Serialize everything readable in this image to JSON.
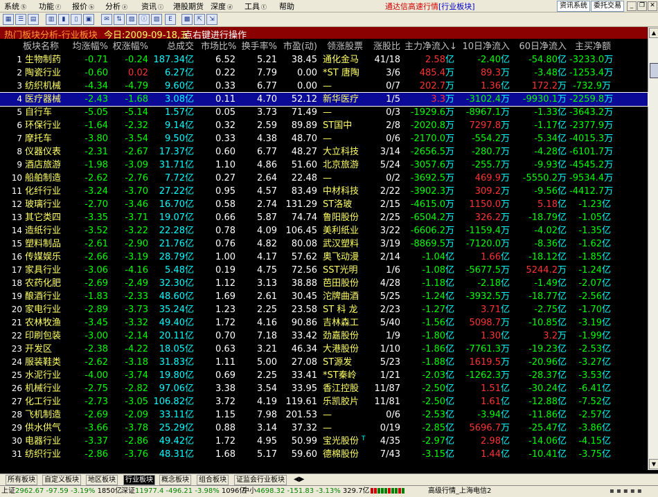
{
  "menubar": {
    "items": [
      "系统",
      "功能",
      "报价",
      "分析",
      "资讯",
      "港股期货",
      "深度",
      "工具",
      "帮助"
    ],
    "has_arrow": [
      true,
      true,
      true,
      true,
      true,
      false,
      true,
      true,
      false
    ],
    "app_title": "通达信高速行情",
    "app_subtitle": "[行业板块]",
    "btn_news": "资讯系统",
    "btn_trade": "委托交易"
  },
  "header": {
    "board_title": "热门板块分析-行业板块",
    "today": "今日:2009-09-18,五",
    "hint": "点右键进行操作"
  },
  "columns": [
    "板块名称",
    "均涨幅%",
    "权涨幅%",
    "总成交",
    "市场比%",
    "换手率%",
    "市盈(动)",
    "领涨股票",
    "涨股比",
    "主力净流入↓",
    "10日净流入",
    "60日净流入",
    "主买净额"
  ],
  "units": {
    "yi": "亿",
    "wan": "万"
  },
  "rows": [
    {
      "i": "1",
      "name": "生物制药",
      "avg": "-0.71",
      "wt": "-0.24",
      "vol": "187.34",
      "mkt": "6.52",
      "turn": "5.21",
      "pe": "38.45",
      "lead": "通化金马",
      "ratio": "41/18",
      "main": "2.58",
      "main_u": "亿",
      "d10": "-2.40",
      "d10_u": "亿",
      "d60": "-54.80",
      "d60_u": "亿",
      "buy": "-3233.0",
      "buy_u": "万"
    },
    {
      "i": "2",
      "name": "陶瓷行业",
      "avg": "-0.60",
      "wt": "0.02",
      "vol": "6.27",
      "mkt": "0.22",
      "turn": "7.79",
      "pe": "0.00",
      "lead": "*ST 唐陶",
      "ratio": "3/6",
      "main": "485.4",
      "main_u": "万",
      "d10": "89.3",
      "d10_u": "万",
      "d60": "-3.48",
      "d60_u": "亿",
      "buy": "-1253.4",
      "buy_u": "万"
    },
    {
      "i": "3",
      "name": "纺织机械",
      "avg": "-4.34",
      "wt": "-4.79",
      "vol": "9.60",
      "mkt": "0.33",
      "turn": "6.77",
      "pe": "0.00",
      "lead": "—",
      "ratio": "0/7",
      "main": "202.7",
      "main_u": "万",
      "d10": "1.36",
      "d10_u": "亿",
      "d60": "172.2",
      "d60_u": "万",
      "buy": "-732.9",
      "buy_u": "万"
    },
    {
      "i": "4",
      "name": "医疗器械",
      "avg": "-2.43",
      "wt": "-1.68",
      "vol": "3.08",
      "mkt": "0.11",
      "turn": "4.70",
      "pe": "52.12",
      "lead": "新华医疗",
      "ratio": "1/5",
      "main": "3.3",
      "main_u": "万",
      "d10": "-3102.4",
      "d10_u": "万",
      "d60": "-9930.1",
      "d60_u": "万",
      "buy": "-2259.8",
      "buy_u": "万"
    },
    {
      "i": "5",
      "name": "自行车",
      "avg": "-5.05",
      "wt": "-5.14",
      "vol": "1.57",
      "mkt": "0.05",
      "turn": "3.73",
      "pe": "71.49",
      "lead": "—",
      "ratio": "0/3",
      "main": "-1929.6",
      "main_u": "万",
      "d10": "-8967.1",
      "d10_u": "万",
      "d60": "-1.33",
      "d60_u": "亿",
      "buy": "-3643.2",
      "buy_u": "万"
    },
    {
      "i": "6",
      "name": "环保行业",
      "avg": "-1.64",
      "wt": "-2.32",
      "vol": "9.14",
      "mkt": "0.32",
      "turn": "2.59",
      "pe": "89.89",
      "lead": "ST国中",
      "ratio": "2/8",
      "main": "-2020.8",
      "main_u": "万",
      "d10": "7297.8",
      "d10_u": "万",
      "d60": "-1.17",
      "d60_u": "亿",
      "buy": "-2377.9",
      "buy_u": "万"
    },
    {
      "i": "7",
      "name": "摩托车",
      "avg": "-3.80",
      "wt": "-3.54",
      "vol": "9.50",
      "mkt": "0.33",
      "turn": "4.38",
      "pe": "48.70",
      "lead": "—",
      "ratio": "0/6",
      "main": "-2170.0",
      "main_u": "万",
      "d10": "-554.2",
      "d10_u": "万",
      "d60": "-5.34",
      "d60_u": "亿",
      "buy": "-4015.3",
      "buy_u": "万"
    },
    {
      "i": "8",
      "name": "仪器仪表",
      "avg": "-2.31",
      "wt": "-2.67",
      "vol": "17.37",
      "mkt": "0.60",
      "turn": "6.77",
      "pe": "48.27",
      "lead": "大立科技",
      "ratio": "3/14",
      "main": "-2656.5",
      "main_u": "万",
      "d10": "-280.7",
      "d10_u": "万",
      "d60": "-4.28",
      "d60_u": "亿",
      "buy": "-6101.7",
      "buy_u": "万"
    },
    {
      "i": "9",
      "name": "酒店旅游",
      "avg": "-1.98",
      "wt": "-3.09",
      "vol": "31.71",
      "mkt": "1.10",
      "turn": "4.86",
      "pe": "51.60",
      "lead": "北京旅游",
      "ratio": "5/24",
      "main": "-3057.6",
      "main_u": "万",
      "d10": "-255.7",
      "d10_u": "万",
      "d60": "-9.93",
      "d60_u": "亿",
      "buy": "-4545.2",
      "buy_u": "万"
    },
    {
      "i": "10",
      "name": "船舶制造",
      "avg": "-2.62",
      "wt": "-2.76",
      "vol": "7.72",
      "mkt": "0.27",
      "turn": "2.64",
      "pe": "22.48",
      "lead": "—",
      "ratio": "0/2",
      "main": "-3692.5",
      "main_u": "万",
      "d10": "469.9",
      "d10_u": "万",
      "d60": "-5550.2",
      "d60_u": "万",
      "buy": "-9534.4",
      "buy_u": "万"
    },
    {
      "i": "11",
      "name": "化纤行业",
      "avg": "-3.24",
      "wt": "-3.70",
      "vol": "27.22",
      "mkt": "0.95",
      "turn": "4.57",
      "pe": "83.49",
      "lead": "中材科技",
      "ratio": "2/22",
      "main": "-3902.3",
      "main_u": "万",
      "d10": "309.2",
      "d10_u": "万",
      "d60": "-9.56",
      "d60_u": "亿",
      "buy": "-4412.7",
      "buy_u": "万"
    },
    {
      "i": "12",
      "name": "玻璃行业",
      "avg": "-2.70",
      "wt": "-3.46",
      "vol": "16.70",
      "mkt": "0.58",
      "turn": "2.74",
      "pe": "131.29",
      "lead": "ST洛玻",
      "ratio": "2/15",
      "main": "-4615.0",
      "main_u": "万",
      "d10": "1150.0",
      "d10_u": "万",
      "d60": "5.18",
      "d60_u": "亿",
      "buy": "-1.23",
      "buy_u": "亿"
    },
    {
      "i": "13",
      "name": "其它类四",
      "avg": "-3.35",
      "wt": "-3.71",
      "vol": "19.07",
      "mkt": "0.66",
      "turn": "5.87",
      "pe": "74.74",
      "lead": "鲁阳股份",
      "ratio": "2/25",
      "main": "-6504.2",
      "main_u": "万",
      "d10": "326.2",
      "d10_u": "万",
      "d60": "-18.79",
      "d60_u": "亿",
      "buy": "-1.05",
      "buy_u": "亿"
    },
    {
      "i": "14",
      "name": "造纸行业",
      "avg": "-3.52",
      "wt": "-3.22",
      "vol": "22.28",
      "mkt": "0.78",
      "turn": "4.09",
      "pe": "106.45",
      "lead": "美利纸业",
      "ratio": "3/22",
      "main": "-6606.2",
      "main_u": "万",
      "d10": "-1159.4",
      "d10_u": "万",
      "d60": "-4.02",
      "d60_u": "亿",
      "buy": "-1.35",
      "buy_u": "亿"
    },
    {
      "i": "15",
      "name": "塑料制品",
      "avg": "-2.61",
      "wt": "-2.90",
      "vol": "21.76",
      "mkt": "0.76",
      "turn": "4.82",
      "pe": "80.08",
      "lead": "武汉塑料",
      "ratio": "3/19",
      "main": "-8869.5",
      "main_u": "万",
      "d10": "-7120.0",
      "d10_u": "万",
      "d60": "-8.36",
      "d60_u": "亿",
      "buy": "-1.62",
      "buy_u": "亿"
    },
    {
      "i": "16",
      "name": "传媒娱乐",
      "avg": "-2.66",
      "wt": "-3.19",
      "vol": "28.79",
      "mkt": "1.00",
      "turn": "4.17",
      "pe": "57.62",
      "lead": "奥飞动漫",
      "ratio": "2/14",
      "main": "-1.04",
      "main_u": "亿",
      "d10": "1.66",
      "d10_u": "亿",
      "d60": "-18.12",
      "d60_u": "亿",
      "buy": "-1.85",
      "buy_u": "亿"
    },
    {
      "i": "17",
      "name": "家具行业",
      "avg": "-3.06",
      "wt": "-4.16",
      "vol": "5.48",
      "mkt": "0.19",
      "turn": "4.75",
      "pe": "72.56",
      "lead": "SST光明",
      "ratio": "1/6",
      "main": "-1.08",
      "main_u": "亿",
      "d10": "-5677.5",
      "d10_u": "万",
      "d60": "5244.2",
      "d60_u": "万",
      "buy": "-1.24",
      "buy_u": "亿"
    },
    {
      "i": "18",
      "name": "农药化肥",
      "avg": "-2.69",
      "wt": "-2.49",
      "vol": "32.30",
      "mkt": "1.12",
      "turn": "3.13",
      "pe": "38.88",
      "lead": "芭田股份",
      "ratio": "4/28",
      "main": "-1.18",
      "main_u": "亿",
      "d10": "-2.18",
      "d10_u": "亿",
      "d60": "-1.49",
      "d60_u": "亿",
      "buy": "-2.07",
      "buy_u": "亿"
    },
    {
      "i": "19",
      "name": "酿酒行业",
      "avg": "-1.83",
      "wt": "-2.33",
      "vol": "48.60",
      "mkt": "1.69",
      "turn": "2.61",
      "pe": "30.45",
      "lead": "沱牌曲酒",
      "ratio": "5/25",
      "main": "-1.24",
      "main_u": "亿",
      "d10": "-3932.5",
      "d10_u": "万",
      "d60": "-18.77",
      "d60_u": "亿",
      "buy": "-2.56",
      "buy_u": "亿"
    },
    {
      "i": "20",
      "name": "家电行业",
      "avg": "-2.89",
      "wt": "-3.73",
      "vol": "35.24",
      "mkt": "1.23",
      "turn": "2.25",
      "pe": "23.58",
      "lead": "ST 科 龙",
      "ratio": "2/23",
      "main": "-1.27",
      "main_u": "亿",
      "d10": "3.71",
      "d10_u": "亿",
      "d60": "-2.75",
      "d60_u": "亿",
      "buy": "-1.70",
      "buy_u": "亿"
    },
    {
      "i": "21",
      "name": "农林牧渔",
      "avg": "-3.45",
      "wt": "-3.32",
      "vol": "49.40",
      "mkt": "1.72",
      "turn": "4.16",
      "pe": "90.86",
      "lead": "吉林森工",
      "ratio": "5/40",
      "main": "-1.56",
      "main_u": "亿",
      "d10": "5098.7",
      "d10_u": "万",
      "d60": "-10.85",
      "d60_u": "亿",
      "buy": "-3.19",
      "buy_u": "亿"
    },
    {
      "i": "22",
      "name": "印刷包装",
      "avg": "-3.00",
      "wt": "-2.14",
      "vol": "20.11",
      "mkt": "0.70",
      "turn": "7.18",
      "pe": "33.42",
      "lead": "劲嘉股份",
      "ratio": "1/9",
      "main": "-1.80",
      "main_u": "亿",
      "d10": "1.30",
      "d10_u": "亿",
      "d60": "3.2",
      "d60_u": "万",
      "buy": "-1.99",
      "buy_u": "亿"
    },
    {
      "i": "23",
      "name": "开发区",
      "avg": "-2.38",
      "wt": "-4.22",
      "vol": "18.05",
      "mkt": "0.63",
      "turn": "3.21",
      "pe": "46.34",
      "lead": "大港股份",
      "ratio": "1/10",
      "main": "-1.86",
      "main_u": "亿",
      "d10": "-7761.3",
      "d10_u": "万",
      "d60": "-19.23",
      "d60_u": "亿",
      "buy": "-2.53",
      "buy_u": "亿"
    },
    {
      "i": "24",
      "name": "服装鞋类",
      "avg": "-2.62",
      "wt": "-3.18",
      "vol": "31.83",
      "mkt": "1.11",
      "turn": "5.00",
      "pe": "27.08",
      "lead": "ST源发",
      "ratio": "5/23",
      "main": "-1.88",
      "main_u": "亿",
      "d10": "1619.5",
      "d10_u": "万",
      "d60": "-20.96",
      "d60_u": "亿",
      "buy": "-3.27",
      "buy_u": "亿"
    },
    {
      "i": "25",
      "name": "水泥行业",
      "avg": "-4.00",
      "wt": "-3.74",
      "vol": "19.80",
      "mkt": "0.69",
      "turn": "2.25",
      "pe": "33.41",
      "lead": "*ST秦岭",
      "ratio": "1/21",
      "main": "-2.03",
      "main_u": "亿",
      "d10": "-1262.3",
      "d10_u": "万",
      "d60": "-28.37",
      "d60_u": "亿",
      "buy": "-3.53",
      "buy_u": "亿"
    },
    {
      "i": "26",
      "name": "机械行业",
      "avg": "-2.75",
      "wt": "-2.82",
      "vol": "97.06",
      "mkt": "3.38",
      "turn": "3.54",
      "pe": "33.95",
      "lead": "香江控股",
      "ratio": "11/87",
      "main": "-2.50",
      "main_u": "亿",
      "d10": "1.51",
      "d10_u": "亿",
      "d60": "-30.24",
      "d60_u": "亿",
      "buy": "-6.41",
      "buy_u": "亿"
    },
    {
      "i": "27",
      "name": "化工行业",
      "avg": "-2.73",
      "wt": "-3.05",
      "vol": "106.82",
      "mkt": "3.72",
      "turn": "4.19",
      "pe": "119.61",
      "lead": "乐凯胶片",
      "ratio": "11/81",
      "main": "-2.50",
      "main_u": "亿",
      "d10": "1.61",
      "d10_u": "亿",
      "d60": "-12.88",
      "d60_u": "亿",
      "buy": "-7.52",
      "buy_u": "亿"
    },
    {
      "i": "28",
      "name": "飞机制造",
      "avg": "-2.69",
      "wt": "-2.09",
      "vol": "33.11",
      "mkt": "1.15",
      "turn": "7.98",
      "pe": "201.53",
      "lead": "—",
      "ratio": "0/6",
      "main": "-2.53",
      "main_u": "亿",
      "d10": "-3.94",
      "d10_u": "亿",
      "d60": "-11.86",
      "d60_u": "亿",
      "buy": "-2.57",
      "buy_u": "亿"
    },
    {
      "i": "29",
      "name": "供水供气",
      "avg": "-3.66",
      "wt": "-3.78",
      "vol": "25.29",
      "mkt": "0.88",
      "turn": "3.14",
      "pe": "37.32",
      "lead": "—",
      "ratio": "0/19",
      "main": "-2.85",
      "main_u": "亿",
      "d10": "5696.7",
      "d10_u": "万",
      "d60": "-25.47",
      "d60_u": "亿",
      "buy": "-3.86",
      "buy_u": "亿"
    },
    {
      "i": "30",
      "name": "电器行业",
      "avg": "-3.37",
      "wt": "-2.86",
      "vol": "49.42",
      "mkt": "1.72",
      "turn": "4.95",
      "pe": "50.99",
      "lead": "宝光股份",
      "lead_mark": "T",
      "ratio": "4/35",
      "main": "-2.97",
      "main_u": "亿",
      "d10": "2.98",
      "d10_u": "亿",
      "d60": "-14.06",
      "d60_u": "亿",
      "buy": "-4.15",
      "buy_u": "亿"
    },
    {
      "i": "31",
      "name": "纺织行业",
      "avg": "-2.86",
      "wt": "-3.76",
      "vol": "48.31",
      "mkt": "1.68",
      "turn": "5.17",
      "pe": "59.60",
      "lead": "德棉股份",
      "ratio": "7/43",
      "main": "-3.15",
      "main_u": "亿",
      "d10": "1.44",
      "d10_u": "亿",
      "d60": "-10.41",
      "d60_u": "亿",
      "buy": "-3.75",
      "buy_u": "亿"
    }
  ],
  "selected_row": 3,
  "tabs": [
    "所有板块",
    "自定义板块",
    "地区板块",
    "行业板块",
    "概念板块",
    "组合板块",
    "证监会行业板块"
  ],
  "active_tab": 3,
  "status": {
    "sh_label": "上证",
    "sh_value": "2962.67",
    "sh_change": "-97.59",
    "sh_pct": "-3.19%",
    "sh_amount": "1850亿",
    "sz_label": "深证",
    "sz_value": "11977.4",
    "sz_change": "-496.21",
    "sz_pct": "-3.98%",
    "sz_amount": "1096亿",
    "zx_label": "中小",
    "zx_value": "4698.32",
    "zx_change": "-151.83",
    "zx_pct": "-3.13%",
    "zx_amount": "329.7亿",
    "server": "高级行情_上海电信2"
  },
  "colors": {
    "up": "#ff3333",
    "down": "#00ff00",
    "name": "#ffff66",
    "unit": "#00ffff",
    "header_bar": "#8b0000"
  }
}
